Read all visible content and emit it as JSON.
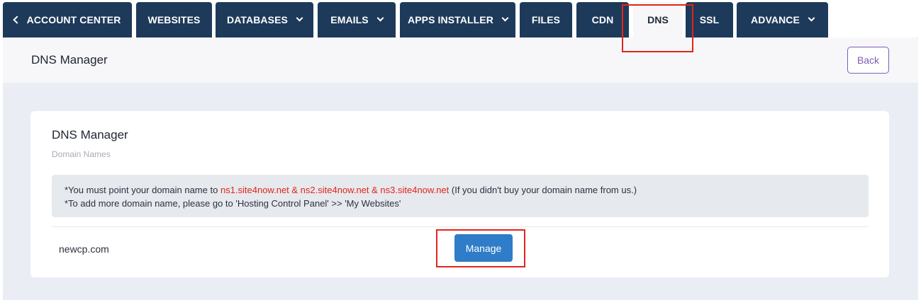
{
  "nav": {
    "tabs": [
      {
        "label": "ACCOUNT CENTER",
        "has_back_icon": true
      },
      {
        "label": "WEBSITES"
      },
      {
        "label": "DATABASES",
        "has_dropdown": true
      },
      {
        "label": "EMAILS",
        "has_dropdown": true
      },
      {
        "label": "APPS INSTALLER",
        "has_dropdown": true
      },
      {
        "label": "FILES"
      },
      {
        "label": "CDN"
      },
      {
        "label": "DNS",
        "active": true
      },
      {
        "label": "SSL"
      },
      {
        "label": "ADVANCE",
        "has_dropdown": true
      }
    ]
  },
  "header": {
    "title": "DNS Manager",
    "back_label": "Back"
  },
  "card": {
    "title": "DNS Manager",
    "subtitle": "Domain Names",
    "notice": {
      "line1_prefix": "*You must point your domain name to ",
      "line1_nameservers": "ns1.site4now.net & ns2.site4now.net & ns3.site4now.net",
      "line1_suffix": " (If you didn't buy your domain name from us.)",
      "line2": "*To add more domain name, please go to 'Hosting Control Panel' >> 'My Websites'"
    },
    "domains": [
      {
        "name": "newcp.com",
        "action_label": "Manage"
      }
    ]
  },
  "colors": {
    "nav_bg": "#1e3a5a",
    "accent_purple": "#7e5bb8",
    "button_blue": "#2f7cc8",
    "highlight_red": "#e3241b"
  }
}
